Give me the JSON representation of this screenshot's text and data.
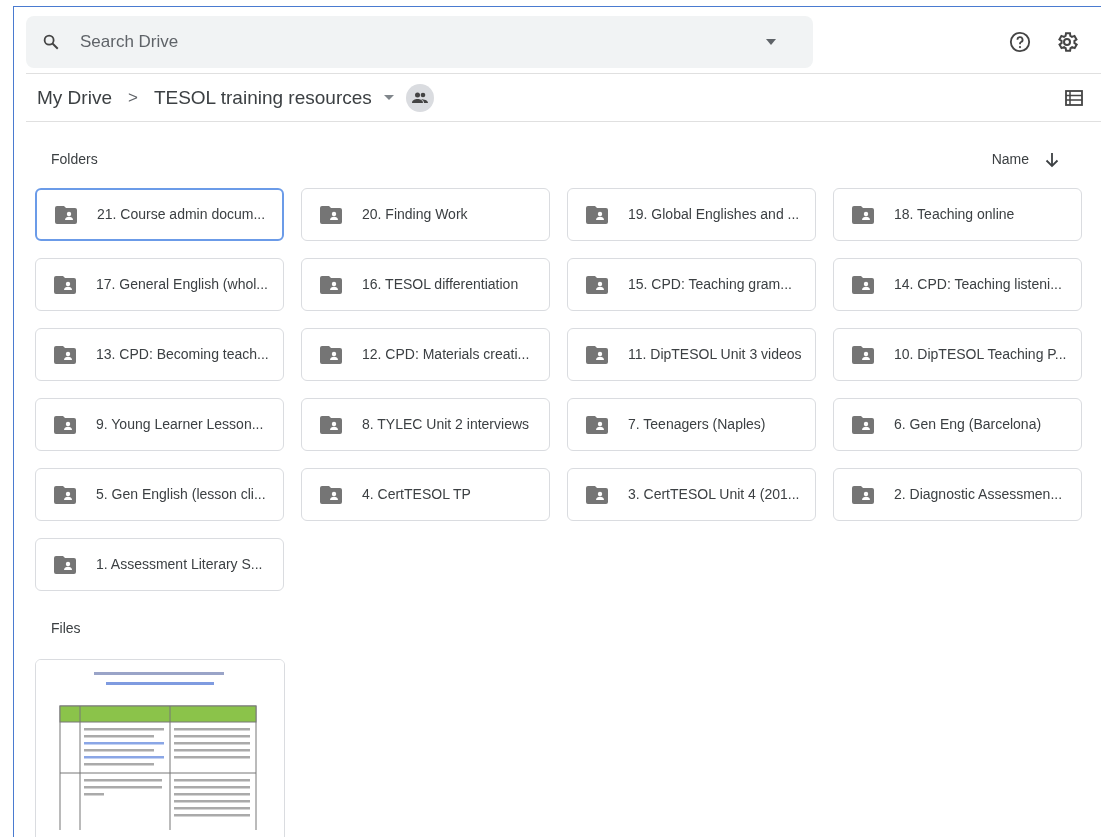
{
  "search": {
    "placeholder": "Search Drive"
  },
  "breadcrumb": {
    "root": "My Drive",
    "separator": ">",
    "current": "TESOL training resources"
  },
  "folders_section": {
    "title": "Folders",
    "sort_label": "Name"
  },
  "folders": [
    {
      "name": "21. Course admin docum...",
      "selected": true
    },
    {
      "name": "20. Finding Work",
      "selected": false
    },
    {
      "name": "19. Global Englishes and ...",
      "selected": false
    },
    {
      "name": "18. Teaching online",
      "selected": false
    },
    {
      "name": "17. General English (whol...",
      "selected": false
    },
    {
      "name": "16. TESOL differentiation",
      "selected": false
    },
    {
      "name": "15. CPD: Teaching gram...",
      "selected": false
    },
    {
      "name": "14. CPD: Teaching listeni...",
      "selected": false
    },
    {
      "name": "13. CPD: Becoming teach...",
      "selected": false
    },
    {
      "name": "12. CPD: Materials creati...",
      "selected": false
    },
    {
      "name": "11. DipTESOL Unit 3 videos",
      "selected": false
    },
    {
      "name": "10. DipTESOL Teaching P...",
      "selected": false
    },
    {
      "name": "9. Young Learner Lesson...",
      "selected": false
    },
    {
      "name": "8. TYLEC Unit 2 interviews",
      "selected": false
    },
    {
      "name": "7. Teenagers (Naples)",
      "selected": false
    },
    {
      "name": "6. Gen Eng (Barcelona)",
      "selected": false
    },
    {
      "name": "5. Gen English (lesson cli...",
      "selected": false
    },
    {
      "name": "4. CertTESOL TP",
      "selected": false
    },
    {
      "name": "3. CertTESOL Unit 4 (201...",
      "selected": false
    },
    {
      "name": "2. Diagnostic Assessmen...",
      "selected": false
    },
    {
      "name": "1. Assessment Literary S...",
      "selected": false
    }
  ],
  "files_section": {
    "title": "Files"
  }
}
